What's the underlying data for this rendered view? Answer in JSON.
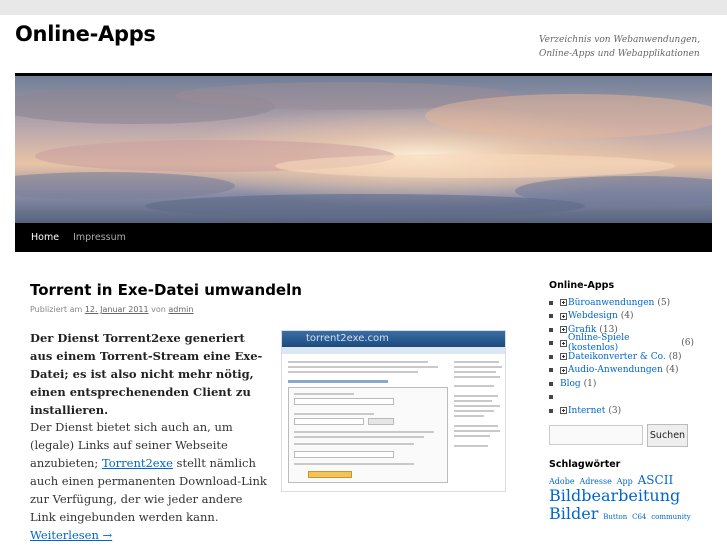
{
  "site": {
    "title": "Online-Apps",
    "description": "Verzeichnis von Webanwendungen, Online-Apps und Webapplikationen"
  },
  "nav": {
    "items": [
      {
        "label": "Home"
      },
      {
        "label": "Impressum"
      }
    ]
  },
  "post": {
    "title": "Torrent in Exe-Datei umwandeln",
    "meta_prefix": "Publiziert am",
    "date": "12. Januar 2011",
    "meta_by": "von",
    "author": "admin",
    "lead": "Der Dienst Torrent2exe generiert aus einem Torrent-Stream eine Exe-Datei; es ist also nicht mehr nötig, einen entsprechenenden Client zu installieren.",
    "body_before": "Der Dienst bietet sich auch an, um (legale) Links auf seiner Webseite anzubieten;",
    "body_link": "Torrent2exe",
    "body_after": "stellt nämlich auch einen permanenten Download-Link zur Verfügung, der wie jeder andere Link eingebunden werden kann.",
    "read_more": "Weiterlesen →",
    "thumbnail_caption": "torrent2exe.com"
  },
  "sidebar": {
    "categories_title": "Online-Apps",
    "categories": [
      {
        "label": "Büroanwendungen",
        "count": "(5)",
        "expandable": true
      },
      {
        "label": "Webdesign",
        "count": "(4)",
        "expandable": true
      },
      {
        "label": "Grafik",
        "count": "(13)",
        "expandable": true
      },
      {
        "label": "Online-Spiele (kostenlos)",
        "count": "(6)",
        "expandable": true
      },
      {
        "label": "Dateikonverter & Co.",
        "count": "(8)",
        "expandable": true
      },
      {
        "label": "Audio-Anwendungen",
        "count": "(4)",
        "expandable": true
      },
      {
        "label": "Blog",
        "count": "(1)",
        "expandable": false
      },
      {
        "label": "",
        "count": "",
        "expandable": false
      },
      {
        "label": "Internet",
        "count": "(3)",
        "expandable": true
      }
    ],
    "search_placeholder": "",
    "search_button": "Suchen",
    "tags_title": "Schlagwörter",
    "tags": [
      {
        "label": "Adobe",
        "size": "s"
      },
      {
        "label": "Adresse",
        "size": "s"
      },
      {
        "label": "App",
        "size": "s"
      },
      {
        "label": "ASCII",
        "size": "m"
      },
      {
        "label": "Bildbearbeitung",
        "size": "l"
      },
      {
        "label": "Bilder",
        "size": "l"
      },
      {
        "label": "Button",
        "size": "s"
      },
      {
        "label": "C64",
        "size": "s"
      },
      {
        "label": "community",
        "size": "s"
      }
    ]
  },
  "colors": {
    "link": "#0066cc",
    "nav_background": "#000000",
    "header_border": "#000000"
  }
}
